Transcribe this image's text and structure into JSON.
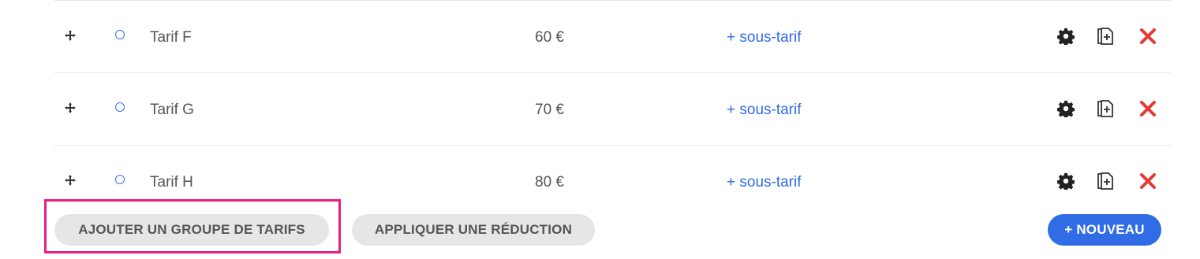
{
  "rows": [
    {
      "name": "Tarif F",
      "price": "60 €",
      "sub_link": "+ sous-tarif"
    },
    {
      "name": "Tarif G",
      "price": "70 €",
      "sub_link": "+ sous-tarif"
    },
    {
      "name": "Tarif H",
      "price": "80 €",
      "sub_link": "+ sous-tarif"
    }
  ],
  "footer": {
    "add_group_label": "AJOUTER UN GROUPE DE TARIFS",
    "apply_discount_label": "APPLIQUER UNE RÉDUCTION",
    "new_label": "+ NOUVEAU"
  },
  "colors": {
    "accent": "#2f6ce5",
    "delete": "#e53935",
    "highlight": "#e61f85",
    "button_grey": "#e6e6e6"
  },
  "icons": [
    "move-icon",
    "radio-icon",
    "gear-icon",
    "duplicate-icon",
    "delete-icon"
  ]
}
